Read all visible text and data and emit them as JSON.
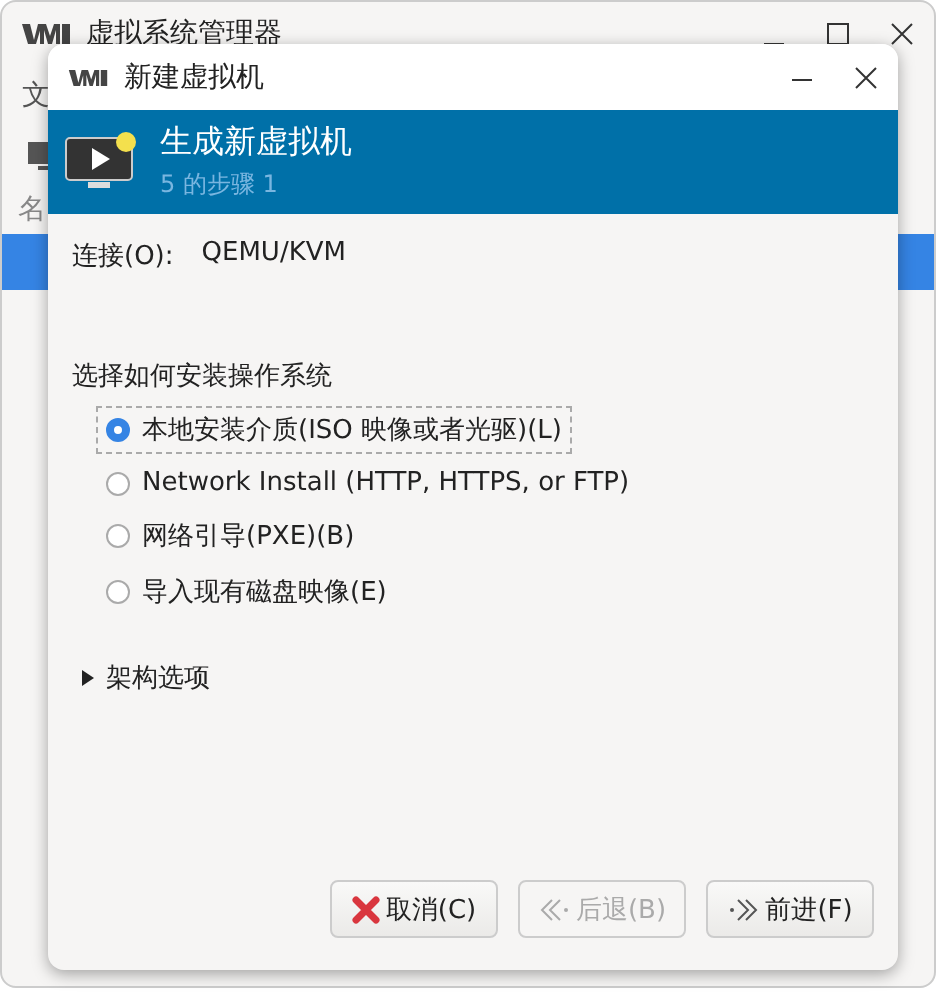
{
  "background_window": {
    "title": "虚拟系统管理器",
    "menu_label": "文",
    "column_label": "名"
  },
  "dialog": {
    "title": "新建虚拟机",
    "header": {
      "title": "生成新虚拟机",
      "subtitle": "5 的步骤 1"
    },
    "connection": {
      "label": "连接(O):",
      "value": "QEMU/KVM"
    },
    "install": {
      "heading": "选择如何安装操作系统",
      "options": [
        {
          "label": "本地安装介质(ISO 映像或者光驱)(L)",
          "selected": true
        },
        {
          "label": "Network Install (HTTP, HTTPS, or FTP)",
          "selected": false
        },
        {
          "label": "网络引导(PXE)(B)",
          "selected": false
        },
        {
          "label": "导入现有磁盘映像(E)",
          "selected": false
        }
      ]
    },
    "expander": {
      "label": "架构选项",
      "expanded": false
    },
    "buttons": [
      {
        "label": "取消(C)",
        "kind": "cancel",
        "disabled": false
      },
      {
        "label": "后退(B)",
        "kind": "back",
        "disabled": true
      },
      {
        "label": "前进(F)",
        "kind": "forward",
        "disabled": false
      }
    ]
  }
}
